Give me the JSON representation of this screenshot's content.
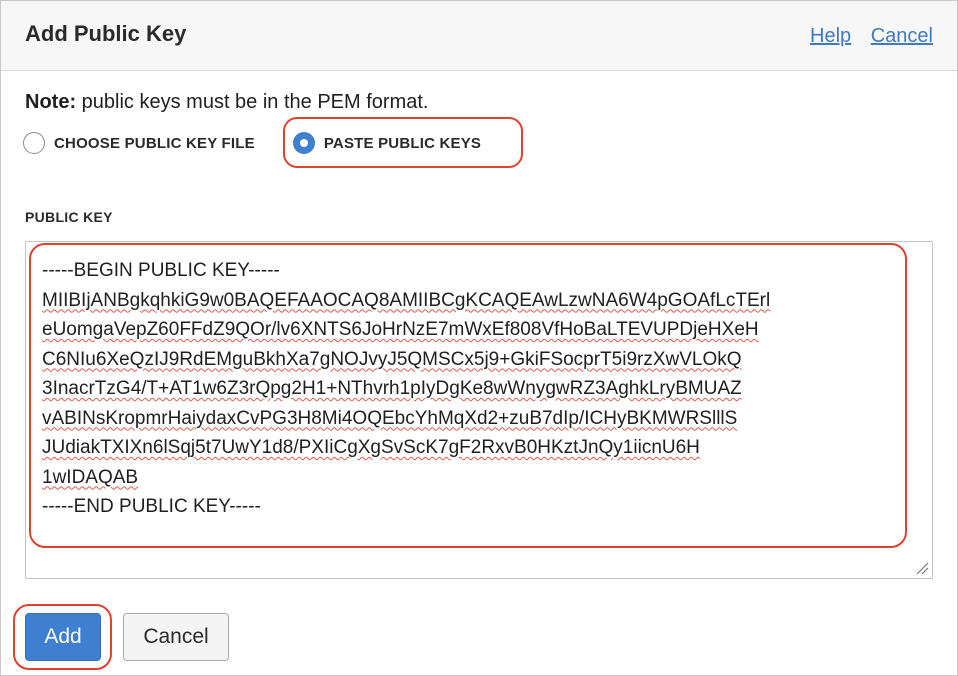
{
  "dialog": {
    "title": "Add Public Key",
    "help_link": "Help",
    "cancel_link": "Cancel"
  },
  "note": {
    "label": "Note:",
    "text": " public keys must be in the PEM format."
  },
  "key_source": {
    "options": [
      {
        "label": "CHOOSE PUBLIC KEY FILE",
        "selected": false
      },
      {
        "label": "PASTE PUBLIC KEYS",
        "selected": true
      }
    ]
  },
  "public_key": {
    "label": "PUBLIC KEY",
    "lines": [
      "-----BEGIN PUBLIC KEY-----",
      "MIIBIjANBgkqhkiG9w0BAQEFAAOCAQ8AMIIBCgKCAQEAwLzwNA6W4pGOAfLcTErl",
      "eUomgaVepZ60FFdZ9QOr/lv6XNTS6JoHrNzE7mWxEf808VfHoBaLTEVUPDjeHXeH",
      "C6NIu6XeQzIJ9RdEMguBkhXa7gNOJvyJ5QMSCx5j9+GkiFSocprT5i9rzXwVLOkQ",
      "3InacrTzG4/T+AT1w6Z3rQpg2H1+NThvrh1pIyDgKe8wWnygwRZ3AghkLryBMUAZ",
      "vABINsKropmrHaiydaxCvPG3H8Mi4OQEbcYhMqXd2+zuB7dIp/ICHyBKMWRSlllS",
      "JUdiakTXIXn6lSqj5t7UwY1d8/PXIiCgXgSvScK7gF2RxvB0HKztJnQy1iicnU6H",
      "1wIDAQAB",
      "-----END PUBLIC KEY-----"
    ]
  },
  "actions": {
    "add_label": "Add",
    "cancel_label": "Cancel"
  },
  "colors": {
    "accent": "#3f7fd0",
    "highlight": "#e2412d",
    "link": "#3d7bc6"
  }
}
